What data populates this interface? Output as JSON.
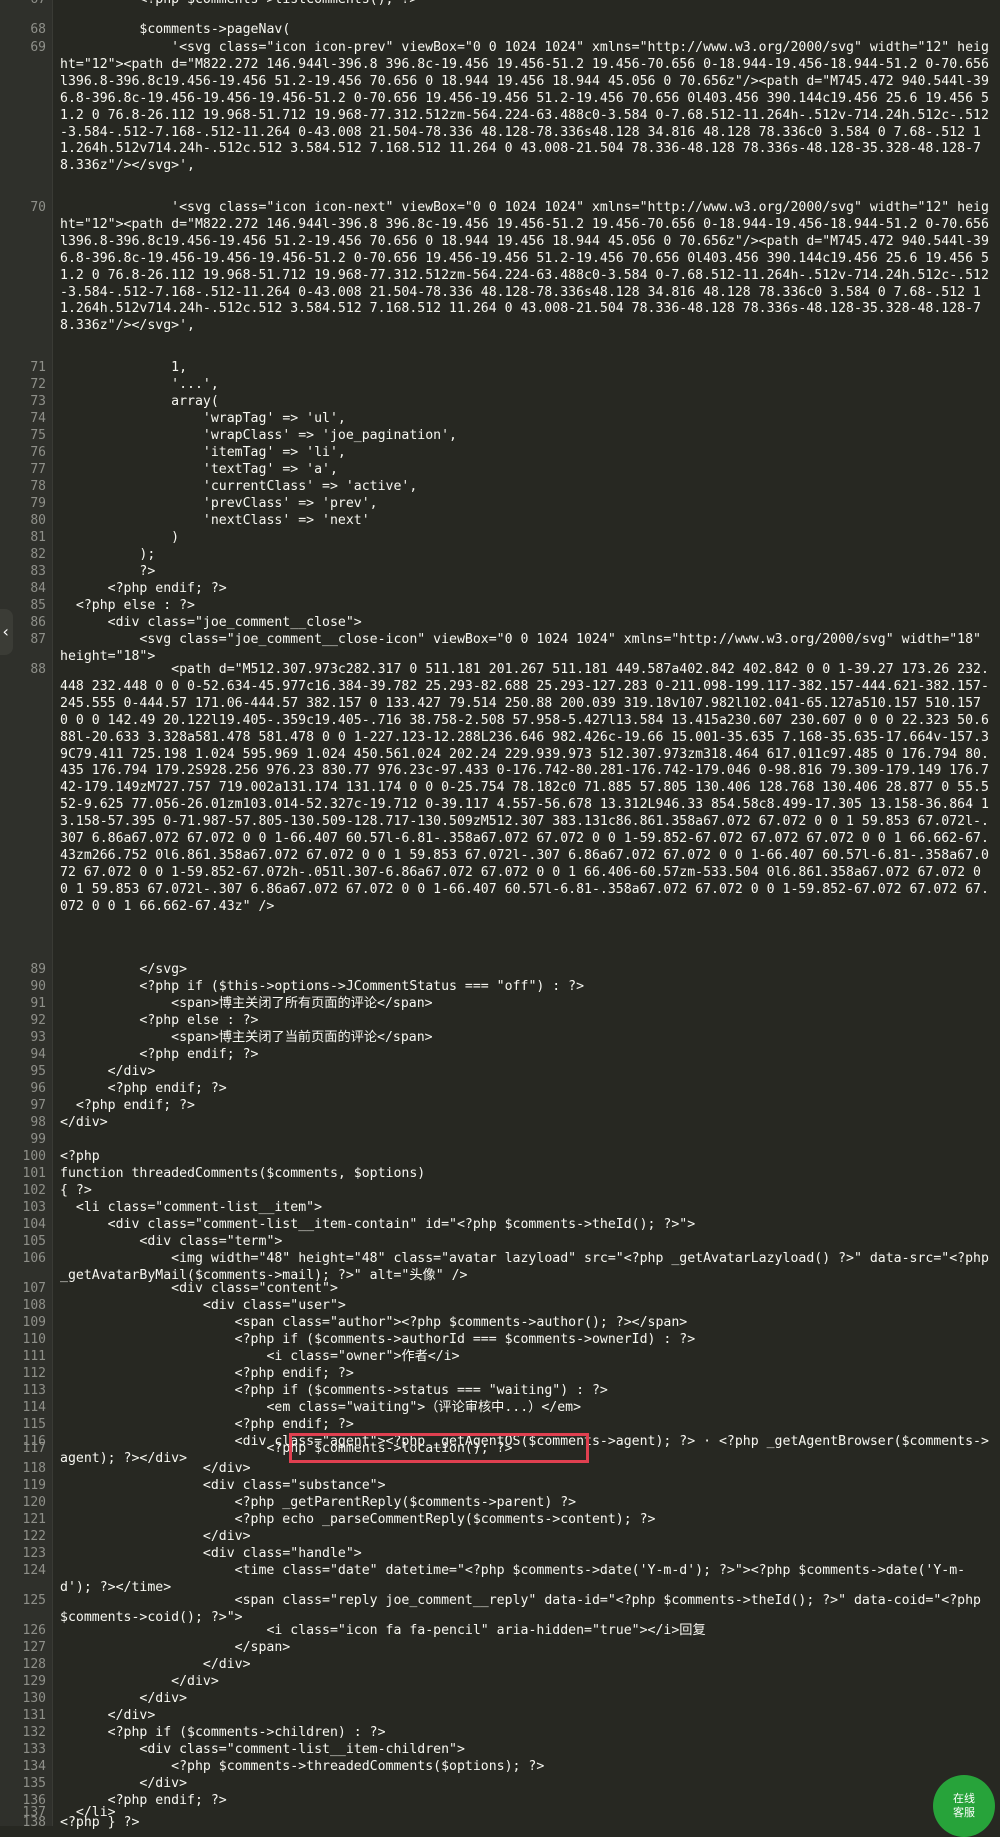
{
  "editor": {
    "highlight_note": "",
    "lines": [
      {
        "n": "67",
        "t": "          <?php $comments->listComments(); ?>"
      },
      {
        "n": "68",
        "t": "          $comments->pageNav("
      },
      {
        "n": "69",
        "t": "              '<svg class=\"icon icon-prev\" viewBox=\"0 0 1024 1024\" xmlns=\"http://www.w3.org/2000/svg\" width=\"12\" height=\"12\"><path d=\"M822.272 146.944l-396.8 396.8c-19.456 19.456-51.2 19.456-70.656 0-18.944-19.456-18.944-51.2 0-70.656l396.8-396.8c19.456-19.456 51.2-19.456 70.656 0 18.944 19.456 18.944 45.056 0 70.656z\"/><path d=\"M745.472 940.544l-396.8-396.8c-19.456-19.456-19.456-51.2 0-70.656 19.456-19.456 51.2-19.456 70.656 0l403.456 390.144c19.456 25.6 19.456 51.2 0 76.8-26.112 19.968-51.712 19.968-77.312.512zm-564.224-63.488c0-3.584 0-7.68.512-11.264h-.512v-714.24h.512c-.512-3.584-.512-7.168-.512-11.264 0-43.008 21.504-78.336 48.128-78.336s48.128 34.816 48.128 78.336c0 3.584 0 7.68-.512 11.264h.512v714.24h-.512c.512 3.584.512 7.168.512 11.264 0 43.008-21.504 78.336-48.128 78.336s-48.128-35.328-48.128-78.336z\"/></svg>',"
      },
      {
        "n": "70",
        "t": "              '<svg class=\"icon icon-next\" viewBox=\"0 0 1024 1024\" xmlns=\"http://www.w3.org/2000/svg\" width=\"12\" height=\"12\"><path d=\"M822.272 146.944l-396.8 396.8c-19.456 19.456-51.2 19.456-70.656 0-18.944-19.456-18.944-51.2 0-70.656l396.8-396.8c19.456-19.456 51.2-19.456 70.656 0 18.944 19.456 18.944 45.056 0 70.656z\"/><path d=\"M745.472 940.544l-396.8-396.8c-19.456-19.456-19.456-51.2 0-70.656 19.456-19.456 51.2-19.456 70.656 0l403.456 390.144c19.456 25.6 19.456 51.2 0 76.8-26.112 19.968-51.712 19.968-77.312.512zm-564.224-63.488c0-3.584 0-7.68.512-11.264h-.512v-714.24h.512c-.512-3.584-.512-7.168-.512-11.264 0-43.008 21.504-78.336 48.128-78.336s48.128 34.816 48.128 78.336c0 3.584 0 7.68-.512 11.264h.512v714.24h-.512c.512 3.584.512 7.168.512 11.264 0 43.008-21.504 78.336-48.128 78.336s-48.128-35.328-48.128-78.336z\"/></svg>',"
      },
      {
        "n": "71",
        "t": "              1,"
      },
      {
        "n": "72",
        "t": "              '...',"
      },
      {
        "n": "73",
        "t": "              array("
      },
      {
        "n": "74",
        "t": "                  'wrapTag' => 'ul',"
      },
      {
        "n": "75",
        "t": "                  'wrapClass' => 'joe_pagination',"
      },
      {
        "n": "76",
        "t": "                  'itemTag' => 'li',"
      },
      {
        "n": "77",
        "t": "                  'textTag' => 'a',"
      },
      {
        "n": "78",
        "t": "                  'currentClass' => 'active',"
      },
      {
        "n": "79",
        "t": "                  'prevClass' => 'prev',"
      },
      {
        "n": "80",
        "t": "                  'nextClass' => 'next'"
      },
      {
        "n": "81",
        "t": "              )"
      },
      {
        "n": "82",
        "t": "          );"
      },
      {
        "n": "83",
        "t": "          ?>"
      },
      {
        "n": "84",
        "t": "      <?php endif; ?>"
      },
      {
        "n": "85",
        "t": "  <?php else : ?>"
      },
      {
        "n": "86",
        "t": "      <div class=\"joe_comment__close\">"
      },
      {
        "n": "87",
        "t": "          <svg class=\"joe_comment__close-icon\" viewBox=\"0 0 1024 1024\" xmlns=\"http://www.w3.org/2000/svg\" width=\"18\" height=\"18\">"
      },
      {
        "n": "88",
        "t": "              <path d=\"M512.307.973c282.317 0 511.181 201.267 511.181 449.587a402.842 402.842 0 0 1-39.27 173.26 232.448 232.448 0 0 0-52.634-45.977c16.384-39.782 25.293-82.688 25.293-127.283 0-211.098-199.117-382.157-444.621-382.157-245.555 0-444.57 171.06-444.57 382.157 0 133.427 79.514 250.88 200.039 319.18v107.982l102.041-65.127a510.157 510.157 0 0 0 142.49 20.122l19.405-.359c19.405-.716 38.758-2.508 57.958-5.427l13.584 13.415a230.607 230.607 0 0 0 22.323 50.688l-20.633 3.328a581.478 581.478 0 0 1-227.123-12.288L236.646 982.426c-19.66 15.001-35.635 7.168-35.635-17.664v-157.39C79.411 725.198 1.024 595.969 1.024 450.561.024 202.24 229.939.973 512.307.973zm318.464 617.011c97.485 0 176.794 80.435 176.794 179.2S928.256 976.23 830.77 976.23c-97.433 0-176.742-80.281-176.742-179.046 0-98.816 79.309-179.149 176.742-179.149zM727.757 719.002a131.174 131.174 0 0 0-25.754 78.182c0 71.885 57.805 130.406 128.768 130.406 28.877 0 55.552-9.625 77.056-26.01zm103.014-52.327c-19.712 0-39.117 4.557-56.678 13.312L946.33 854.58c8.499-17.305 13.158-36.864 13.158-57.395 0-71.987-57.805-130.509-128.717-130.509zM512.307 383.131c86.861.358a67.072 67.072 0 0 1 59.853 67.072l-.307 6.86a67.072 67.072 0 0 1-66.407 60.57l-6.81-.358a67.072 67.072 0 0 1-59.852-67.072 67.072 67.072 0 0 1 66.662-67.43zm266.752 0l6.861.358a67.072 67.072 0 0 1 59.853 67.072l-.307 6.86a67.072 67.072 0 0 1-66.407 60.57l-6.81-.358a67.072 67.072 0 0 1-59.852-67.072h-.051l.307-6.86a67.072 67.072 0 0 1 66.406-60.57zm-533.504 0l6.861.358a67.072 67.072 0 0 1 59.853 67.072l-.307 6.86a67.072 67.072 0 0 1-66.407 60.57l-6.81-.358a67.072 67.072 0 0 1-59.852-67.072 67.072 67.072 0 0 1 66.662-67.43z\" />"
      },
      {
        "n": "89",
        "t": "          </svg>"
      },
      {
        "n": "90",
        "t": "          <?php if ($this->options->JCommentStatus === \"off\") : ?>"
      },
      {
        "n": "91",
        "t": "              <span>博主关闭了所有页面的评论</span>"
      },
      {
        "n": "92",
        "t": "          <?php else : ?>"
      },
      {
        "n": "93",
        "t": "              <span>博主关闭了当前页面的评论</span>"
      },
      {
        "n": "94",
        "t": "          <?php endif; ?>"
      },
      {
        "n": "95",
        "t": "      </div>"
      },
      {
        "n": "96",
        "t": "      <?php endif; ?>"
      },
      {
        "n": "97",
        "t": "  <?php endif; ?>"
      },
      {
        "n": "98",
        "t": "</div>"
      },
      {
        "n": "99",
        "t": ""
      },
      {
        "n": "100",
        "t": "<?php"
      },
      {
        "n": "101",
        "t": "function threadedComments($comments, $options)"
      },
      {
        "n": "102",
        "t": "{ ?>"
      },
      {
        "n": "103",
        "t": "  <li class=\"comment-list__item\">"
      },
      {
        "n": "104",
        "t": "      <div class=\"comment-list__item-contain\" id=\"<?php $comments->theId(); ?>\">"
      },
      {
        "n": "105",
        "t": "          <div class=\"term\">"
      },
      {
        "n": "106",
        "t": "              <img width=\"48\" height=\"48\" class=\"avatar lazyload\" src=\"<?php _getAvatarLazyload() ?>\" data-src=\"<?php _getAvatarByMail($comments->mail); ?>\" alt=\"头像\" />"
      },
      {
        "n": "107",
        "t": "              <div class=\"content\">"
      },
      {
        "n": "108",
        "t": "                  <div class=\"user\">"
      },
      {
        "n": "109",
        "t": "                      <span class=\"author\"><?php $comments->author(); ?></span>"
      },
      {
        "n": "110",
        "t": "                      <?php if ($comments->authorId === $comments->ownerId) : ?>"
      },
      {
        "n": "111",
        "t": "                          <i class=\"owner\">作者</i>"
      },
      {
        "n": "112",
        "t": "                      <?php endif; ?>"
      },
      {
        "n": "113",
        "t": "                      <?php if ($comments->status === \"waiting\") : ?>"
      },
      {
        "n": "114",
        "t": "                          <em class=\"waiting\">（评论审核中...）</em>"
      },
      {
        "n": "115",
        "t": "                      <?php endif; ?>"
      },
      {
        "n": "116",
        "t": "                      <div class=\"agent\"><?php _getAgentOS($comments->agent); ?> · <?php _getAgentBrowser($comments->agent); ?></div>"
      },
      {
        "n": "117",
        "t": "                          <?php $comments->location(); ?>"
      },
      {
        "n": "118",
        "t": "                  </div>"
      },
      {
        "n": "119",
        "t": "                  <div class=\"substance\">"
      },
      {
        "n": "120",
        "t": "                      <?php _getParentReply($comments->parent) ?>"
      },
      {
        "n": "121",
        "t": "                      <?php echo _parseCommentReply($comments->content); ?>"
      },
      {
        "n": "122",
        "t": "                  </div>"
      },
      {
        "n": "123",
        "t": "                  <div class=\"handle\">"
      },
      {
        "n": "124",
        "t": "                      <time class=\"date\" datetime=\"<?php $comments->date('Y-m-d'); ?>\"><?php $comments->date('Y-m-d'); ?></time>"
      },
      {
        "n": "125",
        "t": "                      <span class=\"reply joe_comment__reply\" data-id=\"<?php $comments->theId(); ?>\" data-coid=\"<?php $comments->coid(); ?>\">"
      },
      {
        "n": "126",
        "t": "                          <i class=\"icon fa fa-pencil\" aria-hidden=\"true\"></i>回复"
      },
      {
        "n": "127",
        "t": "                      </span>"
      },
      {
        "n": "128",
        "t": "                  </div>"
      },
      {
        "n": "129",
        "t": "              </div>"
      },
      {
        "n": "130",
        "t": "          </div>"
      },
      {
        "n": "131",
        "t": "      </div>"
      },
      {
        "n": "132",
        "t": "      <?php if ($comments->children) : ?>"
      },
      {
        "n": "133",
        "t": "          <div class=\"comment-list__item-children\">"
      },
      {
        "n": "134",
        "t": "              <?php $comments->threadedComments($options); ?>"
      },
      {
        "n": "135",
        "t": "          </div>"
      },
      {
        "n": "136",
        "t": "      <?php endif; ?>"
      },
      {
        "n": "137",
        "t": "  </li>"
      },
      {
        "n": "138",
        "t": "<?php } ?>"
      }
    ]
  },
  "chat_button": {
    "line1": "在线",
    "line2": "客服"
  },
  "left_handle": {
    "glyph": "‹"
  },
  "colors": {
    "background": "#272822",
    "gutter": "#2f302b",
    "highlight_box": "#e04050",
    "chat_button": "#27a33a"
  }
}
